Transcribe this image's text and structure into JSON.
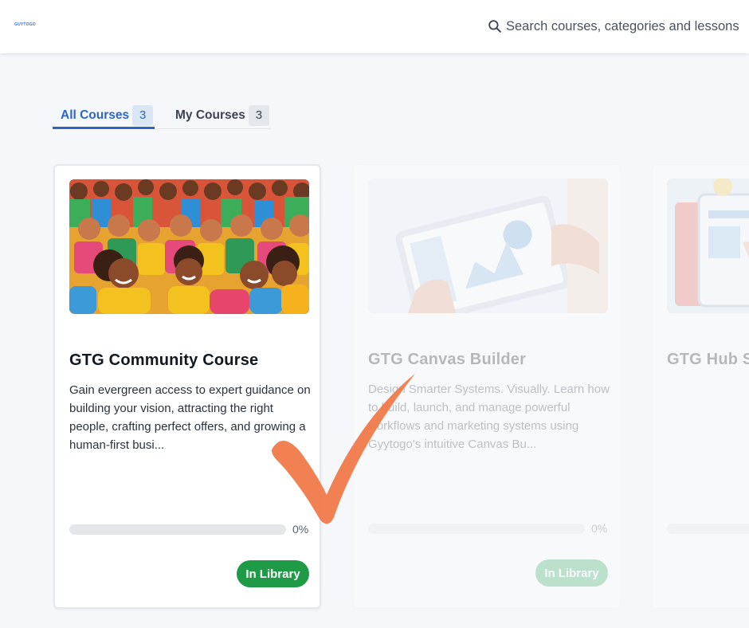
{
  "header": {
    "logo_text": "GUYTOGO",
    "search": {
      "placeholder": "Search courses, categories and lessons",
      "icon": "search-icon"
    }
  },
  "tabs": [
    {
      "label": "All Courses",
      "count": "3",
      "active": true
    },
    {
      "label": "My Courses",
      "count": "3",
      "active": false
    }
  ],
  "courses": [
    {
      "title": "GTG Community Course",
      "description": "Gain evergreen access to expert guidance on building your vision, attracting the right people, crafting perfect offers, and growing a human-first busi...",
      "progress": 0,
      "progress_label": "0%",
      "button_label": "In Library"
    },
    {
      "title": "GTG Canvas Builder",
      "description": "Design Smarter Systems. Visually. Learn how to build, launch, and manage powerful workflows and marketing systems using Gyytogo's intuitive Canvas Bu...",
      "progress": 0,
      "progress_label": "0%",
      "button_label": "In Library"
    },
    {
      "title": "GTG Hub Se",
      "description": "",
      "progress": 0,
      "progress_label": "",
      "button_label": ""
    }
  ],
  "colors": {
    "accent": "#2b66c7",
    "library_button": "#1f9b47",
    "checkmark": "#f07a4a"
  },
  "overlay": {
    "icon": "checkmark-icon"
  }
}
